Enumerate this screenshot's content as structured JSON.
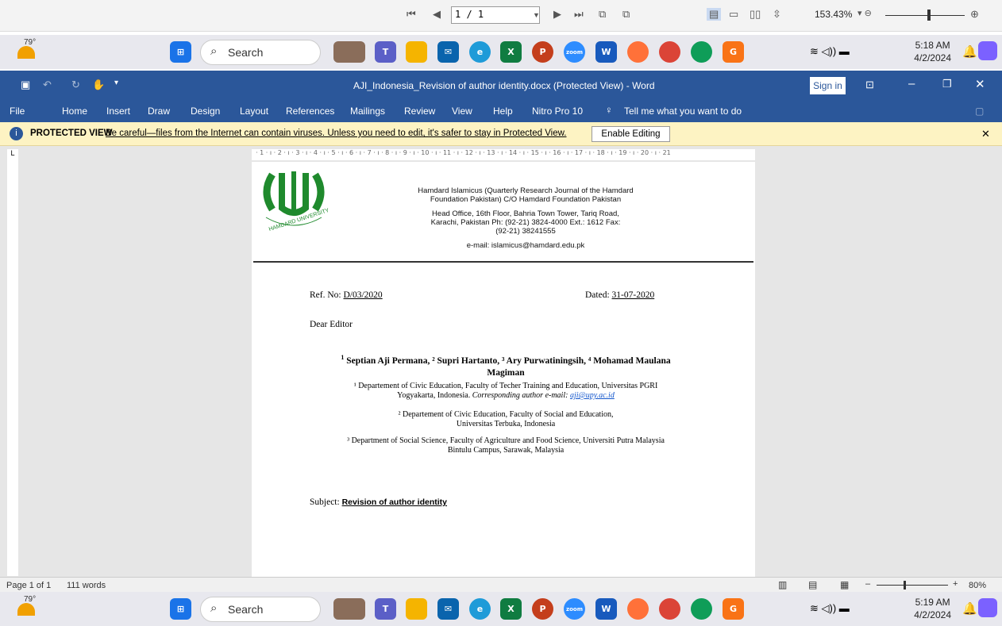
{
  "pdf_toolbar": {
    "page_value": "1 / 1",
    "zoom": "153.43%"
  },
  "taskbar": {
    "temperature": "79°",
    "search_label": "Search",
    "top_time": "5:18 AM",
    "top_date": "4/2/2024",
    "bottom_time": "5:19 AM",
    "bottom_date": "4/2/2024"
  },
  "word": {
    "title": "AJI_Indonesia_Revision of author identity.docx (Protected View) - Word",
    "sign_in": "Sign in",
    "menu": [
      "File",
      "Home",
      "Insert",
      "Draw",
      "Design",
      "Layout",
      "References",
      "Mailings",
      "Review",
      "View",
      "Help",
      "Nitro Pro 10"
    ],
    "tell_me": "Tell me what you want to do",
    "protected_label": "PROTECTED VIEW",
    "protected_message": "Be careful—files from the Internet can contain viruses. Unless you need to edit, it's safer to stay in Protected View.",
    "enable_editing": "Enable Editing",
    "status_page": "Page 1 of 1",
    "status_words": "111 words",
    "status_zoom": "80%"
  },
  "document": {
    "logo_text": "HAMDARD UNIVERSITY",
    "header_line1": "Hamdard Islamicus (Quarterly Research Journal of the Hamdard",
    "header_line2": "Foundation Pakistan) C/O Hamdard Foundation Pakistan",
    "address_line1": "Head Office, 16th Floor, Bahria Town Tower, Tariq Road,",
    "address_line2": "Karachi, Pakistan Ph: (92-21) 3824-4000 Ext.: 1612 Fax:",
    "address_line3": "(92-21) 38241555",
    "email": "e-mail: islamicus@hamdard.edu.pk",
    "ref_label": "Ref. No: ",
    "ref_value": "D/03/2020",
    "dated_label": "Dated: ",
    "dated_value": "31-07-2020",
    "salutation": "Dear Editor",
    "authors_line1": "Septian Aji Permana, ² Supri Hartanto, ³ Ary Purwatiningsih, ⁴ Mohamad Maulana",
    "authors_sup1": "1",
    "authors_line2": "Magiman",
    "aff1_line1": "¹ Departement of Civic Education, Faculty of Techer Training and Education, Universitas PGRI",
    "aff1_line2": "Yogyakarta, Indonesia. ",
    "aff1_italic": "Corresponding author e-mail: ",
    "aff1_email": "aji@upy.ac.id",
    "aff2_line1": "² Departement of Civic Education, Faculty of Social and Education,",
    "aff2_line2": "Universitas Terbuka, Indonesia",
    "aff3_line1": "³ Department of Social Science, Faculty of Agriculture and Food Science, Universiti Putra Malaysia",
    "aff3_line2": "Bintulu Campus, Sarawak, Malaysia",
    "subject_label": "Subject: ",
    "subject_value": "Revision of author identity"
  },
  "colors": {
    "word_blue": "#2b579a",
    "protected_bg": "#fdf3c3",
    "logo_green": "#1f8a2d"
  }
}
